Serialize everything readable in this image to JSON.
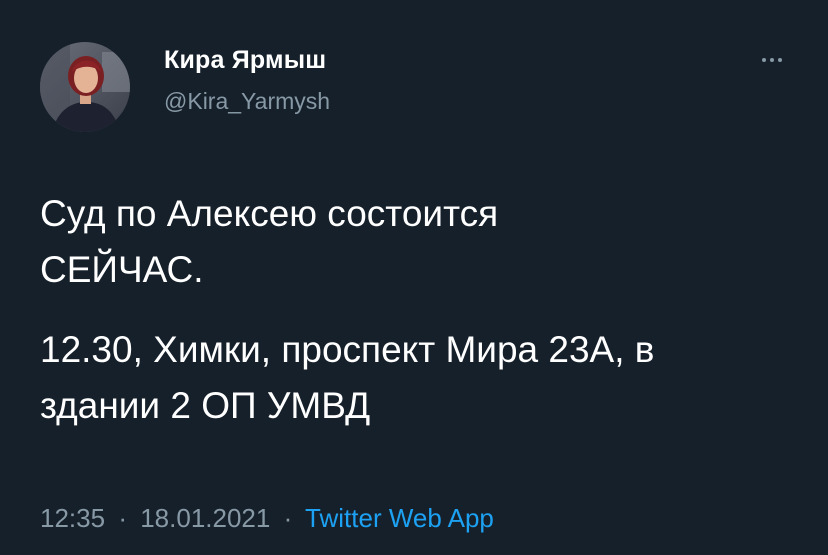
{
  "author": {
    "name": "Кира Ярмыш",
    "handle": "@Kira_Yarmysh"
  },
  "tweet": {
    "lines": [
      "Суд по Алексею состоится",
      "СЕЙЧАС.",
      "12.30, Химки, проспект Мира 23А, в",
      "здании 2 ОП УМВД"
    ]
  },
  "meta": {
    "time": "12:35",
    "separator": "·",
    "date": "18.01.2021",
    "source": "Twitter Web App"
  },
  "icons": {
    "more": "more-horizontal-icon",
    "avatar": "profile-avatar"
  },
  "colors": {
    "background": "#15202b",
    "text": "#ffffff",
    "secondary_text": "#8899a6",
    "link": "#1da1f2"
  }
}
